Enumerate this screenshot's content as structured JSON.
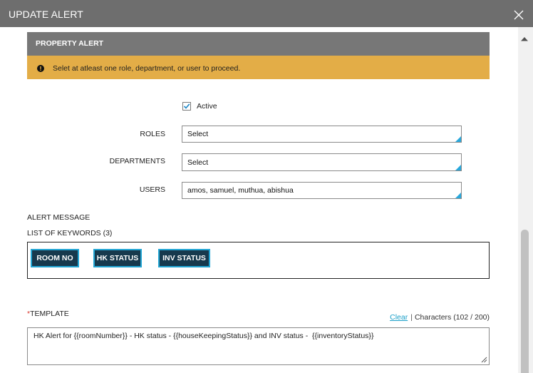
{
  "dialog": {
    "title": "UPDATE ALERT",
    "close_icon": "close-icon"
  },
  "section": {
    "title": "PROPERTY ALERT"
  },
  "warning": {
    "icon": "exclamation-circle-icon",
    "text": "Selet at atleast one role, department, or user to proceed."
  },
  "form": {
    "active": {
      "label": "Active",
      "checked": true,
      "icon": "check-icon"
    },
    "roles": {
      "label": "ROLES",
      "value": "Select"
    },
    "departments": {
      "label": "DEPARTMENTS",
      "value": "Select"
    },
    "users": {
      "label": "USERS",
      "value": "amos, samuel, muthua, abishua"
    },
    "select_icon": "dropdown-corner-icon"
  },
  "alert_message": {
    "title": "ALERT MESSAGE",
    "keywords_label": "LIST OF KEYWORDS (3)",
    "keywords": [
      "ROOM NO",
      "HK STATUS",
      "INV STATUS"
    ]
  },
  "template": {
    "required_marker": "*",
    "label": "TEMPLATE",
    "clear_label": "Clear",
    "separator": "|",
    "characters_label": "Characters (102 / 200)",
    "value": "HK Alert for {{roomNumber}} - HK status - {{houseKeepingStatus}} and INV status -  {{inventoryStatus}}",
    "resize_icon": "resize-handle-icon"
  },
  "scrollbar": {
    "up_icon": "scroll-up-arrow-icon"
  },
  "colors": {
    "title_bar": "#6e6e6e",
    "section_header": "#777777",
    "warning": "#e3ad47",
    "accent": "#29a8dc",
    "link": "#1a9fc8",
    "required": "#d9342b",
    "chip_bg": "#17394d",
    "chip_border": "#22a6d4"
  }
}
